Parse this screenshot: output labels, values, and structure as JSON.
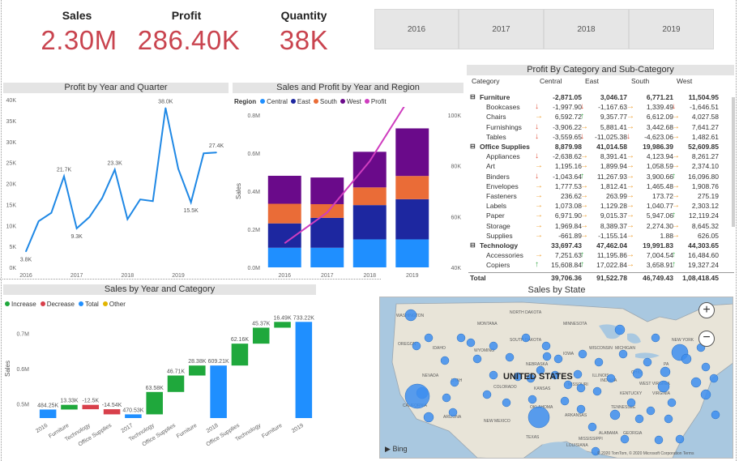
{
  "kpis": [
    {
      "title": "Sales",
      "value": "2.30M"
    },
    {
      "title": "Profit",
      "value": "286.40K"
    },
    {
      "title": "Quantity",
      "value": "38K"
    }
  ],
  "year_slicer": [
    "2016",
    "2017",
    "2018",
    "2019"
  ],
  "profit_quarter": {
    "title": "Profit by Year and Quarter",
    "chart_data": {
      "type": "line",
      "x": [
        1,
        2,
        3,
        4,
        5,
        6,
        7,
        8,
        9,
        10,
        11,
        12,
        13,
        14,
        15,
        16
      ],
      "values": [
        3.8,
        11.0,
        13.0,
        21.7,
        9.3,
        12.0,
        16.5,
        23.3,
        11.5,
        16.2,
        15.8,
        38.0,
        23.5,
        15.5,
        27.2,
        27.4
      ],
      "y_ticks": [
        "0K",
        "5K",
        "10K",
        "15K",
        "20K",
        "25K",
        "30K",
        "35K",
        "40K"
      ],
      "x_ticks": [
        "2016",
        "2017",
        "2018",
        "2019"
      ],
      "ylim": [
        0,
        40
      ],
      "data_labels": [
        {
          "i": 0,
          "text": "3.8K"
        },
        {
          "i": 3,
          "text": "21.7K"
        },
        {
          "i": 4,
          "text": "9.3K"
        },
        {
          "i": 7,
          "text": "23.3K"
        },
        {
          "i": 11,
          "text": "38.0K"
        },
        {
          "i": 13,
          "text": "15.5K"
        },
        {
          "i": 15,
          "text": "27.4K"
        }
      ],
      "color": "#1f88e5"
    }
  },
  "sales_region": {
    "title": "Sales and Profit by Year and Region",
    "legend_title": "Region",
    "legend": [
      {
        "name": "Central",
        "color": "#1f8fff"
      },
      {
        "name": "East",
        "color": "#1d27a0"
      },
      {
        "name": "South",
        "color": "#ea6c37"
      },
      {
        "name": "West",
        "color": "#6a0a8a"
      },
      {
        "name": "Profit",
        "color": "#cf3dbf"
      }
    ],
    "ylabel": "Sales",
    "chart_data": {
      "type": "bar",
      "categories": [
        "2016",
        "2017",
        "2018",
        "2019"
      ],
      "series": [
        {
          "name": "Central",
          "values": [
            0.103,
            0.103,
            0.147,
            0.147
          ]
        },
        {
          "name": "East",
          "values": [
            0.128,
            0.157,
            0.18,
            0.211
          ]
        },
        {
          "name": "South",
          "values": [
            0.103,
            0.072,
            0.093,
            0.122
          ]
        },
        {
          "name": "West",
          "values": [
            0.147,
            0.14,
            0.187,
            0.25
          ]
        }
      ],
      "line": {
        "name": "Profit",
        "values": [
          49.5,
          61.6,
          81.8,
          108.4
        ]
      },
      "y_ticks": [
        "0.0M",
        "0.2M",
        "0.4M",
        "0.6M",
        "0.8M"
      ],
      "y2_ticks": [
        "40K",
        "60K",
        "80K",
        "100K"
      ],
      "ylim": [
        0,
        0.8
      ],
      "y2lim": [
        40,
        100
      ]
    }
  },
  "pivot": {
    "title": "Profit By Category and Sub-Category",
    "columns": [
      "Category",
      "Central",
      "East",
      "South",
      "West"
    ],
    "rows": [
      {
        "name": "Furniture",
        "level": 0,
        "vals": [
          "-2,871.05",
          "3,046.17",
          "6,771.21",
          "11,504.95"
        ],
        "arrows": [
          "",
          "",
          "",
          ""
        ]
      },
      {
        "name": "Bookcases",
        "level": 1,
        "vals": [
          "-1,997.90",
          "-1,167.63",
          "1,339.49",
          "-1,646.51"
        ],
        "arrows": [
          "down",
          "down",
          "right",
          "down"
        ]
      },
      {
        "name": "Chairs",
        "level": 1,
        "vals": [
          "6,592.72",
          "9,357.77",
          "6,612.09",
          "4,027.58"
        ],
        "arrows": [
          "right",
          "up",
          "right",
          "right"
        ]
      },
      {
        "name": "Furnishings",
        "level": 1,
        "vals": [
          "-3,906.22",
          "5,881.41",
          "3,442.68",
          "7,641.27"
        ],
        "arrows": [
          "down",
          "right",
          "right",
          "right"
        ]
      },
      {
        "name": "Tables",
        "level": 1,
        "vals": [
          "-3,559.65",
          "-11,025.38",
          "-4,623.06",
          "1,482.61"
        ],
        "arrows": [
          "down",
          "down",
          "down",
          "right"
        ]
      },
      {
        "name": "Office Supplies",
        "level": 0,
        "vals": [
          "8,879.98",
          "41,014.58",
          "19,986.39",
          "52,609.85"
        ],
        "arrows": [
          "",
          "",
          "",
          ""
        ]
      },
      {
        "name": "Appliances",
        "level": 1,
        "vals": [
          "-2,638.62",
          "8,391.41",
          "4,123.94",
          "8,261.27"
        ],
        "arrows": [
          "down",
          "right",
          "right",
          "right"
        ]
      },
      {
        "name": "Art",
        "level": 1,
        "vals": [
          "1,195.16",
          "1,899.94",
          "1,058.59",
          "2,374.10"
        ],
        "arrows": [
          "right",
          "right",
          "right",
          "right"
        ]
      },
      {
        "name": "Binders",
        "level": 1,
        "vals": [
          "-1,043.64",
          "11,267.93",
          "3,900.66",
          "16,096.80"
        ],
        "arrows": [
          "down",
          "up",
          "right",
          "up"
        ]
      },
      {
        "name": "Envelopes",
        "level": 1,
        "vals": [
          "1,777.53",
          "1,812.41",
          "1,465.48",
          "1,908.76"
        ],
        "arrows": [
          "right",
          "right",
          "right",
          "right"
        ]
      },
      {
        "name": "Fasteners",
        "level": 1,
        "vals": [
          "236.62",
          "263.99",
          "173.72",
          "275.19"
        ],
        "arrows": [
          "right",
          "right",
          "right",
          "right"
        ]
      },
      {
        "name": "Labels",
        "level": 1,
        "vals": [
          "1,073.08",
          "1,129.28",
          "1,040.77",
          "2,303.12"
        ],
        "arrows": [
          "right",
          "right",
          "right",
          "right"
        ]
      },
      {
        "name": "Paper",
        "level": 1,
        "vals": [
          "6,971.90",
          "9,015.37",
          "5,947.06",
          "12,119.24"
        ],
        "arrows": [
          "right",
          "right",
          "right",
          "up"
        ]
      },
      {
        "name": "Storage",
        "level": 1,
        "vals": [
          "1,969.84",
          "8,389.37",
          "2,274.30",
          "8,645.32"
        ],
        "arrows": [
          "right",
          "right",
          "right",
          "right"
        ]
      },
      {
        "name": "Supplies",
        "level": 1,
        "vals": [
          "-661.89",
          "-1,155.14",
          "1.88",
          "626.05"
        ],
        "arrows": [
          "right",
          "right",
          "right",
          "right"
        ]
      },
      {
        "name": "Technology",
        "level": 0,
        "vals": [
          "33,697.43",
          "47,462.04",
          "19,991.83",
          "44,303.65"
        ],
        "arrows": [
          "",
          "",
          "",
          ""
        ]
      },
      {
        "name": "Accessories",
        "level": 1,
        "vals": [
          "7,251.63",
          "11,195.86",
          "7,004.54",
          "16,484.60"
        ],
        "arrows": [
          "right",
          "up",
          "right",
          "up"
        ]
      },
      {
        "name": "Copiers",
        "level": 1,
        "vals": [
          "15,608.84",
          "17,022.84",
          "3,658.91",
          "19,327.24"
        ],
        "arrows": [
          "up",
          "up",
          "right",
          "up"
        ]
      }
    ],
    "total": {
      "name": "Total",
      "vals": [
        "39,706.36",
        "91,522.78",
        "46,749.43",
        "1,08,418.45"
      ]
    }
  },
  "waterfall": {
    "title": "Sales by Year and Category",
    "legend": [
      {
        "name": "Increase",
        "color": "#1fa83c"
      },
      {
        "name": "Decrease",
        "color": "#d8404b"
      },
      {
        "name": "Total",
        "color": "#1f8fff"
      },
      {
        "name": "Other",
        "color": "#e2b500"
      }
    ],
    "ylabel": "Sales",
    "chart_data": {
      "type": "bar",
      "categories": [
        "2016",
        "Furniture",
        "Technology",
        "Office Supplies",
        "2017",
        "Technology",
        "Office Supplies",
        "Furniture",
        "2018",
        "Office Supplies",
        "Technology",
        "Furniture",
        "2019"
      ],
      "values": [
        484.25,
        13.33,
        -12.5,
        -14.54,
        470.53,
        63.58,
        46.71,
        28.38,
        609.21,
        62.16,
        45.37,
        16.49,
        733.22
      ],
      "kinds": [
        "total",
        "inc",
        "dec",
        "dec",
        "total",
        "inc",
        "inc",
        "inc",
        "total",
        "inc",
        "inc",
        "inc",
        "total"
      ],
      "labels": [
        "484.25K",
        "13.33K",
        "-12.5K",
        "-14.54K",
        "470.53K",
        "63.58K",
        "46.71K",
        "28.38K",
        "609.21K",
        "62.16K",
        "45.37K",
        "16.49K",
        "733.22K"
      ],
      "y_ticks": [
        "0.5M",
        "0.6M",
        "0.7M"
      ],
      "ylim": [
        0.46,
        0.75
      ]
    }
  },
  "map": {
    "title": "Sales by State",
    "country_label": "UNITED STATES",
    "bing": "Bing",
    "copyright": "© 2020 TomTom, © 2020 Microsoft Corporation Terms",
    "zoom_in": "+",
    "zoom_out": "−",
    "state_labels": [
      "WASHINGTON",
      "OREGON",
      "IDAHO",
      "MONTANA",
      "NORTH DAKOTA",
      "SOUTH DAKOTA",
      "WYOMING",
      "NEVADA",
      "UTAH",
      "COLORADO",
      "CALIFORNIA",
      "ARIZONA",
      "NEW MEXICO",
      "NEBRASKA",
      "KANSAS",
      "OKLAHOMA",
      "TEXAS",
      "MINNESOTA",
      "IOWA",
      "MISSOURI",
      "ARKANSAS",
      "LOUISIANA",
      "MISSISSIPPI",
      "ALABAMA",
      "GEORGIA",
      "TENNESSEE",
      "KENTUCKY",
      "ILLINOIS",
      "INDIANA",
      "OHIO",
      "MICHIGAN",
      "WISCONSIN",
      "WEST VIRGINIA",
      "VIRGINIA",
      "NEW YORK",
      "PA"
    ]
  }
}
